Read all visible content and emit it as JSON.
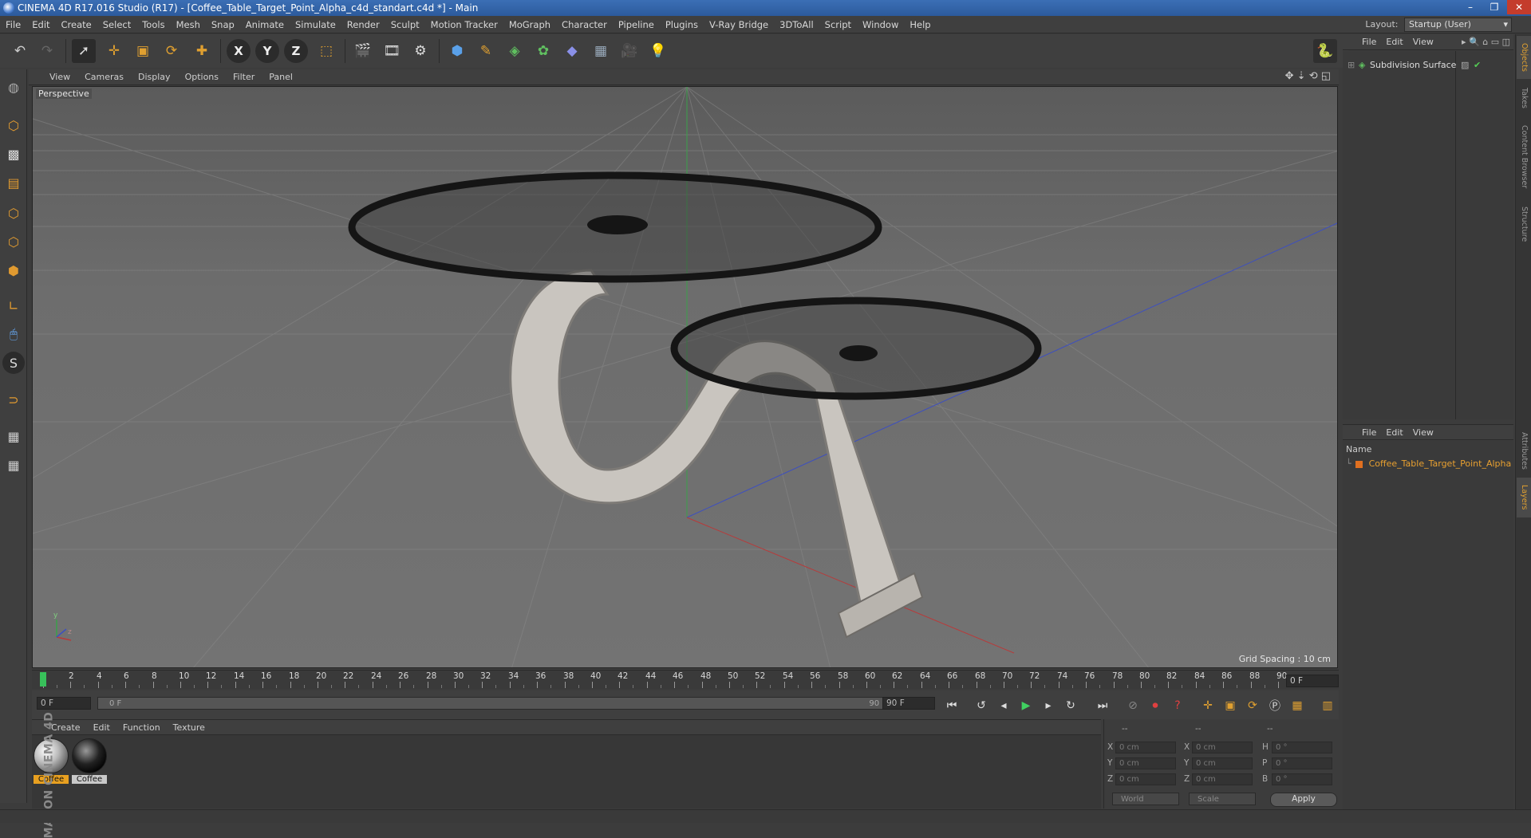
{
  "window": {
    "title": "CINEMA 4D R17.016 Studio (R17) - [Coffee_Table_Target_Point_Alpha_c4d_standart.c4d *] - Main",
    "minimize_glyph": "–",
    "restore_glyph": "❐",
    "close_glyph": "✕"
  },
  "menubar": {
    "items": [
      "File",
      "Edit",
      "Create",
      "Select",
      "Tools",
      "Mesh",
      "Snap",
      "Animate",
      "Simulate",
      "Render",
      "Sculpt",
      "Motion Tracker",
      "MoGraph",
      "Character",
      "Pipeline",
      "Plugins",
      "V-Ray Bridge",
      "3DToAll",
      "Script",
      "Window",
      "Help"
    ],
    "layout_label": "Layout:",
    "layout_value": "Startup (User)"
  },
  "toolbar": {
    "x_label": "X",
    "y_label": "Y",
    "z_label": "Z"
  },
  "viewport": {
    "menu": [
      "View",
      "Cameras",
      "Display",
      "Options",
      "Filter",
      "Panel"
    ],
    "camera_label": "Perspective",
    "grid_spacing": "Grid Spacing : 10 cm",
    "axis_y": "y",
    "axis_z": "z"
  },
  "timeline": {
    "ticks": [
      "0",
      "2",
      "4",
      "6",
      "8",
      "10",
      "12",
      "14",
      "16",
      "18",
      "20",
      "22",
      "24",
      "26",
      "28",
      "30",
      "32",
      "34",
      "36",
      "38",
      "40",
      "42",
      "44",
      "46",
      "48",
      "50",
      "52",
      "54",
      "56",
      "58",
      "60",
      "62",
      "64",
      "66",
      "68",
      "70",
      "72",
      "74",
      "76",
      "78",
      "80",
      "82",
      "84",
      "86",
      "88",
      "90"
    ],
    "current_frame": "0 F",
    "start_field": "0 F",
    "slider_start": "0 F",
    "slider_end": "90 F",
    "end_field": "90 F"
  },
  "materials": {
    "menu": [
      "Create",
      "Edit",
      "Function",
      "Texture"
    ],
    "items": [
      {
        "label": "Coffee"
      },
      {
        "label": "Coffee"
      }
    ]
  },
  "coordinates": {
    "header_dashes": [
      "--",
      "--",
      "--"
    ],
    "rows": [
      {
        "pos_label": "X",
        "pos": "0 cm",
        "size_label": "X",
        "size": "0 cm",
        "rot_label": "H",
        "rot": "0 °"
      },
      {
        "pos_label": "Y",
        "pos": "0 cm",
        "size_label": "Y",
        "size": "0 cm",
        "rot_label": "P",
        "rot": "0 °"
      },
      {
        "pos_label": "Z",
        "pos": "0 cm",
        "size_label": "Z",
        "size": "0 cm",
        "rot_label": "B",
        "rot": "0 °"
      }
    ],
    "space_dropdown": "World",
    "mode_dropdown": "Scale",
    "apply": "Apply"
  },
  "object_manager": {
    "menu": [
      "File",
      "Edit",
      "View"
    ],
    "objects": [
      {
        "name": "Subdivision Surface"
      }
    ]
  },
  "layer_manager": {
    "menu": [
      "File",
      "Edit",
      "View"
    ],
    "name_header": "Name",
    "layers": [
      {
        "name": "Coffee_Table_Target_Point_Alpha"
      }
    ]
  },
  "side_tabs": [
    "Objects",
    "Takes",
    "Content Browser",
    "Structure",
    "Attributes",
    "Layers"
  ],
  "brand": "MAXON CINEMA 4D"
}
